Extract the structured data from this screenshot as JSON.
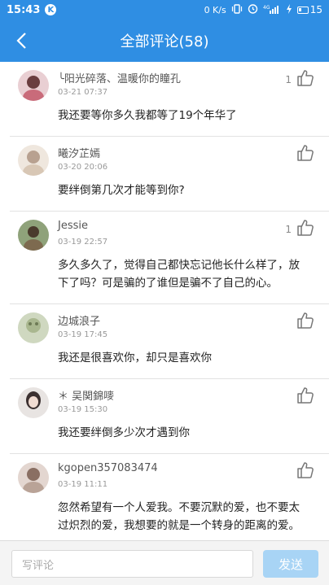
{
  "status_bar": {
    "time": "15:43",
    "k": "K",
    "net_speed": "0 K/s",
    "battery": "15"
  },
  "header": {
    "title": "全部评论(58)"
  },
  "comments": [
    {
      "name": "╰阳光碎落、温暖你的瞳孔",
      "date": "03-21 07:37",
      "likes": "1",
      "text": "我还要等你多久我都等了19个年华了",
      "avatar_color": "#c96b7a"
    },
    {
      "name": "曦汐芷嫣",
      "date": "03-20 20:06",
      "likes": "",
      "text": "要绊倒第几次才能等到你?",
      "avatar_color": "#d8c7b5"
    },
    {
      "name": "Jessie",
      "date": "03-19 22:57",
      "likes": "1",
      "text": "多久多久了，觉得自己都快忘记他长什么样了，放下了吗？可是骗的了谁但是骗不了自己的心。",
      "avatar_color": "#7d6a4f"
    },
    {
      "name": "边城浪子",
      "date": "03-19 17:45",
      "likes": "",
      "text": "我还是很喜欢你，却只是喜欢你",
      "avatar_color": "#a9b78f"
    },
    {
      "name": "＊ 吴関錦嘜",
      "date": "03-19 15:30",
      "likes": "",
      "text": "我还要绊倒多少次才遇到你",
      "avatar_color": "#3b3030"
    },
    {
      "name": "kgopen357083474",
      "date": "03-19 11:11",
      "likes": "",
      "text": "忽然希望有一个人爱我。不要沉默的爱，也不要太过炽烈的爱，我想要的就是一个转身的距离的爱。",
      "avatar_color": "#b9a397"
    }
  ],
  "footer": {
    "placeholder": "写评论",
    "send": "发送"
  }
}
